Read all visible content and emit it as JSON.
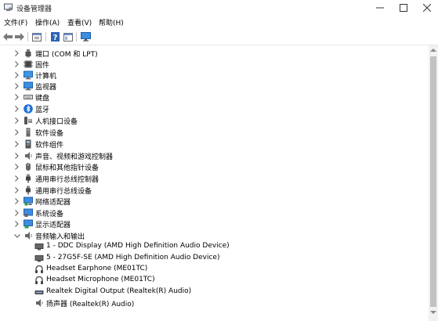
{
  "window": {
    "title": "设备管理器"
  },
  "menu": [
    {
      "label": "文件(F)"
    },
    {
      "label": "操作(A)"
    },
    {
      "label": "查看(V)"
    },
    {
      "label": "帮助(H)"
    }
  ],
  "toolbar": [
    {
      "icon": "back-arrow-icon"
    },
    {
      "icon": "forward-arrow-icon"
    },
    {
      "icon": "properties-icon"
    },
    {
      "icon": "show-hide-console-tree-icon"
    },
    {
      "icon": "help-icon"
    },
    {
      "icon": "action-pane-icon"
    },
    {
      "icon": "monitor-scan-icon"
    }
  ],
  "tree": [
    {
      "label": "端口 (COM 和 LPT)",
      "icon": "port-icon",
      "expanded": false
    },
    {
      "label": "固件",
      "icon": "firmware-icon",
      "expanded": false
    },
    {
      "label": "计算机",
      "icon": "computer-icon",
      "expanded": false
    },
    {
      "label": "监视器",
      "icon": "monitor-icon",
      "expanded": false
    },
    {
      "label": "键盘",
      "icon": "keyboard-icon",
      "expanded": false
    },
    {
      "label": "蓝牙",
      "icon": "bluetooth-icon",
      "expanded": false
    },
    {
      "label": "人机接口设备",
      "icon": "hid-icon",
      "expanded": false
    },
    {
      "label": "软件设备",
      "icon": "software-device-icon",
      "expanded": false
    },
    {
      "label": "软件组件",
      "icon": "software-component-icon",
      "expanded": false
    },
    {
      "label": "声音、视频和游戏控制器",
      "icon": "speaker-icon",
      "expanded": false
    },
    {
      "label": "鼠标和其他指针设备",
      "icon": "mouse-icon",
      "expanded": false
    },
    {
      "label": "通用串行总线控制器",
      "icon": "usb-icon",
      "expanded": false
    },
    {
      "label": "通用串行总线设备",
      "icon": "usb-device-icon",
      "expanded": false
    },
    {
      "label": "网络适配器",
      "icon": "network-adapter-icon",
      "expanded": false
    },
    {
      "label": "系统设备",
      "icon": "system-device-icon",
      "expanded": false
    },
    {
      "label": "显示适配器",
      "icon": "display-adapter-icon",
      "expanded": false
    },
    {
      "label": "音频输入和输出",
      "icon": "audio-io-icon",
      "expanded": true,
      "children": [
        {
          "label": "1 - DDC Display (AMD High Definition Audio Device)",
          "icon": "display-device-icon"
        },
        {
          "label": "5 - 27G5F-SE (AMD High Definition Audio Device)",
          "icon": "display-device-icon"
        },
        {
          "label": "Headset Earphone (ME01TC)",
          "icon": "headset-icon"
        },
        {
          "label": "Headset Microphone (ME01TC)",
          "icon": "headset-icon"
        },
        {
          "label": "Realtek Digital Output (Realtek(R) Audio)",
          "icon": "digital-output-icon"
        },
        {
          "label": "扬声器 (Realtek(R) Audio)",
          "icon": "speaker-icon"
        }
      ]
    }
  ],
  "colors": {
    "chevron": "#555555",
    "tree_icon_blue": "#2d7fd3",
    "scroll_thumb": "#c2c2c2"
  }
}
